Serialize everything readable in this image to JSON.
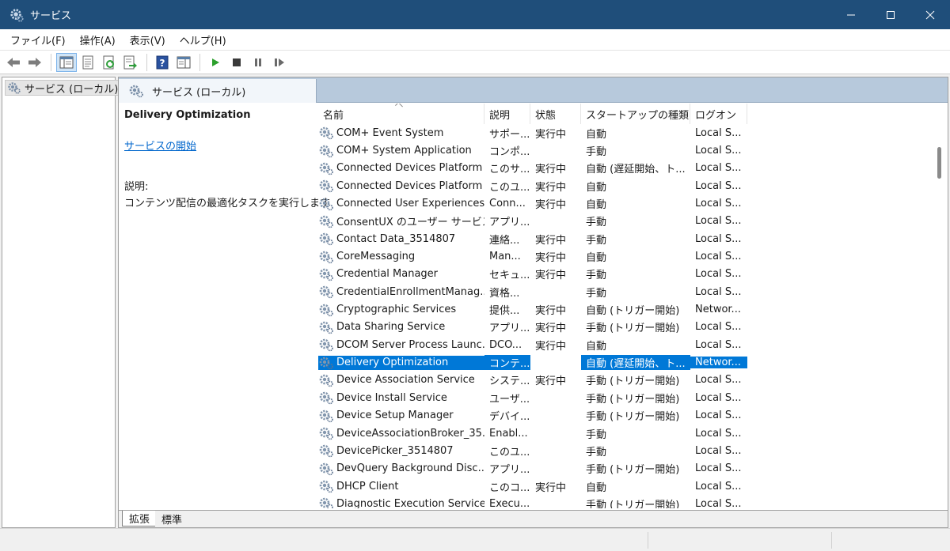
{
  "window": {
    "title": "サービス",
    "icon": "gear-icon"
  },
  "menu": [
    "ファイル(F)",
    "操作(A)",
    "表示(V)",
    "ヘルプ(H)"
  ],
  "toolbar_icons": [
    "back-arrow-icon",
    "forward-arrow-icon",
    "show-hide-tree-icon",
    "properties-icon",
    "refresh-icon",
    "export-list-icon",
    "help-icon",
    "show-hide-action-pane-icon",
    "start-service-icon",
    "stop-service-icon",
    "pause-service-icon",
    "restart-service-icon"
  ],
  "tree": {
    "item": "サービス (ローカル)"
  },
  "header": {
    "tab": "サービス (ローカル)"
  },
  "detail": {
    "name": "Delivery Optimization",
    "start_link": "サービスの開始",
    "desc_label": "説明:",
    "desc_text": "コンテンツ配信の最適化タスクを実行します"
  },
  "columns": [
    "名前",
    "説明",
    "状態",
    "スタートアップの種類",
    "ログオン"
  ],
  "rows": [
    [
      "COM+ Event System",
      "サポー...",
      "実行中",
      "自動",
      "Local S..."
    ],
    [
      "COM+ System Application",
      "コンポ...",
      "",
      "手動",
      "Local S..."
    ],
    [
      "Connected Devices Platform ...",
      "このサ...",
      "実行中",
      "自動 (遅延開始、ト...",
      "Local S..."
    ],
    [
      "Connected Devices Platform ...",
      "このユ...",
      "実行中",
      "自動",
      "Local S..."
    ],
    [
      "Connected User Experiences ...",
      "Conn...",
      "実行中",
      "自動",
      "Local S..."
    ],
    [
      "ConsentUX のユーザー サービス_...",
      "アプリ...",
      "",
      "手動",
      "Local S..."
    ],
    [
      "Contact Data_3514807",
      "連絡...",
      "実行中",
      "手動",
      "Local S..."
    ],
    [
      "CoreMessaging",
      "Man...",
      "実行中",
      "自動",
      "Local S..."
    ],
    [
      "Credential Manager",
      "セキュ...",
      "実行中",
      "手動",
      "Local S..."
    ],
    [
      "CredentialEnrollmentManag...",
      "資格...",
      "",
      "手動",
      "Local S..."
    ],
    [
      "Cryptographic Services",
      "提供...",
      "実行中",
      "自動 (トリガー開始)",
      "Networ..."
    ],
    [
      "Data Sharing Service",
      "アプリ...",
      "実行中",
      "手動 (トリガー開始)",
      "Local S..."
    ],
    [
      "DCOM Server Process Launc...",
      "DCO...",
      "実行中",
      "自動",
      "Local S..."
    ],
    [
      "Delivery Optimization",
      "コンテ...",
      "",
      "自動 (遅延開始、ト...",
      "Networ..."
    ],
    [
      "Device Association Service",
      "システ...",
      "実行中",
      "手動 (トリガー開始)",
      "Local S..."
    ],
    [
      "Device Install Service",
      "ユーザ...",
      "",
      "手動 (トリガー開始)",
      "Local S..."
    ],
    [
      "Device Setup Manager",
      "デバイ...",
      "",
      "手動 (トリガー開始)",
      "Local S..."
    ],
    [
      "DeviceAssociationBroker_35...",
      "Enabl...",
      "",
      "手動",
      "Local S..."
    ],
    [
      "DevicePicker_3514807",
      "このユ...",
      "",
      "手動",
      "Local S..."
    ],
    [
      "DevQuery Background Disc...",
      "アプリ...",
      "",
      "手動 (トリガー開始)",
      "Local S..."
    ],
    [
      "DHCP Client",
      "このコ...",
      "実行中",
      "自動",
      "Local S..."
    ],
    [
      "Diagnostic Execution Service",
      "Execu...",
      "",
      "手動 (トリガー開始)",
      "Local S..."
    ]
  ],
  "selected_row": 13,
  "bottom_tabs": [
    "拡張",
    "標準"
  ],
  "colors": {
    "titlebar": "#1f4e7a",
    "selection": "#0078d7",
    "link": "#0066cc"
  }
}
